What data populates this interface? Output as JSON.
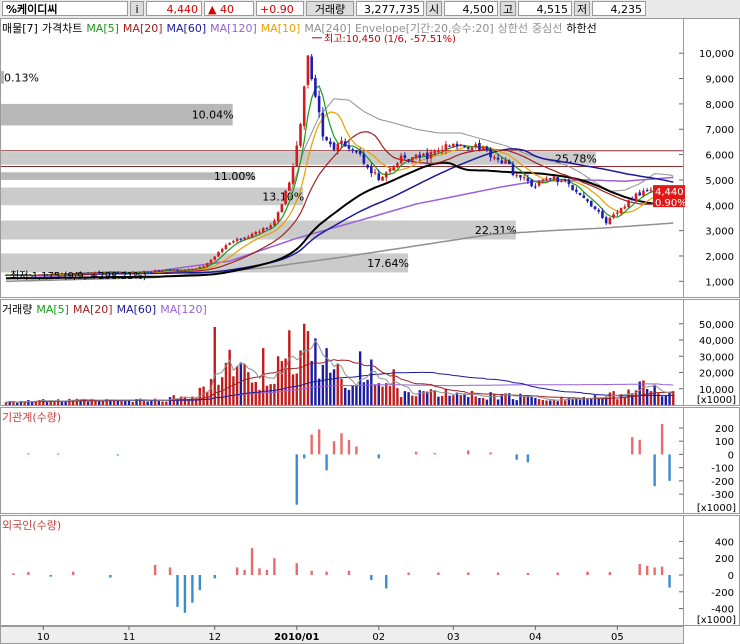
{
  "header": {
    "stock_name": "%케이디씨",
    "info_marker": "i",
    "price": "4,440",
    "change": "▲ 40",
    "change_pct": "+0.90",
    "volume_label": "거래량",
    "volume": "3,277,735",
    "open_label": "시",
    "open": "4,500",
    "high_label": "고",
    "high": "4,515",
    "low_label": "저",
    "low": "4,235"
  },
  "colors": {
    "ma5": "#1a9a1a",
    "ma10": "#e8a000",
    "ma20": "#a02020",
    "ma60": "#1a1a9a",
    "ma120": "#9a60d8",
    "ma240": "#909090",
    "envelope": "#909090",
    "up": "#d41c1c",
    "down": "#1c1cb4",
    "bar_up": "#e86a6a",
    "bar_down": "#3a8ad4",
    "price_tag_bg": "#e01818"
  },
  "chart_data": [
    {
      "type": "candlestick",
      "panel": "price",
      "legend": [
        {
          "text": "매물[7]",
          "color": "#000000"
        },
        {
          "text": "가격차트",
          "color": "#000000"
        },
        {
          "text": "MA[5]",
          "color": "#1a9a1a"
        },
        {
          "text": "MA[20]",
          "color": "#a02020"
        },
        {
          "text": "MA[60]",
          "color": "#1a1a9a"
        },
        {
          "text": "MA[120]",
          "color": "#9a60d8"
        },
        {
          "text": "MA[10]",
          "color": "#e8a000"
        },
        {
          "text": "MA[240]",
          "color": "#909090"
        },
        {
          "text": "Envelope[기간:20,승수:20]",
          "color": "#909090"
        },
        {
          "text": "상한선",
          "color": "#909090"
        },
        {
          "text": "중심선",
          "color": "#909090"
        },
        {
          "text": "하한선",
          "color": "#000000"
        }
      ],
      "ylim": [
        500,
        10600
      ],
      "y_ticks": [
        1000,
        2000,
        3000,
        4000,
        5000,
        6000,
        7000,
        8000,
        9000,
        10000
      ],
      "y_tick_labels": [
        "1,000",
        "2,000",
        "3,000",
        "4,000",
        "5,000",
        "6,000",
        "7,000",
        "8,000",
        "9,000",
        "10,000"
      ],
      "x_labels": [
        {
          "label": "10",
          "index": 10
        },
        {
          "label": "11",
          "index": 33
        },
        {
          "label": "12",
          "index": 56
        },
        {
          "label": "2010/01",
          "index": 78
        },
        {
          "label": "02",
          "index": 100
        },
        {
          "label": "03",
          "index": 120
        },
        {
          "label": "04",
          "index": 142
        },
        {
          "label": "05",
          "index": 164
        }
      ],
      "volume_profile": [
        {
          "price_low": 5600,
          "price_high": 6100,
          "pct_label": "25.78%"
        },
        {
          "price_low": 4000,
          "price_high": 4700,
          "pct_label": "13.10%"
        },
        {
          "price_low": 2650,
          "price_high": 3400,
          "pct_label": "22.31%"
        },
        {
          "price_low": 1350,
          "price_high": 2100,
          "pct_label": "17.64%"
        },
        {
          "price_low": 5000,
          "price_high": 5300,
          "pct_label": "11.00%"
        },
        {
          "price_low": 7150,
          "price_high": 8000,
          "pct_label": "10.04%"
        },
        {
          "price_low": 8800,
          "price_high": 9300,
          "pct_label": "0.13%"
        }
      ],
      "hlines": [
        {
          "value": 6150,
          "color": "#8b2b2b"
        },
        {
          "value": 5530,
          "color": "#8b2b2b"
        }
      ],
      "close_profile": [
        [
          0,
          1220
        ],
        [
          8,
          1240
        ],
        [
          16,
          1300
        ],
        [
          22,
          1350
        ],
        [
          28,
          1370
        ],
        [
          32,
          1320
        ],
        [
          38,
          1380
        ],
        [
          44,
          1450
        ],
        [
          50,
          1470
        ],
        [
          54,
          1680
        ],
        [
          57,
          2150
        ],
        [
          60,
          2500
        ],
        [
          63,
          2650
        ],
        [
          66,
          2850
        ],
        [
          69,
          3100
        ],
        [
          72,
          3400
        ],
        [
          75,
          4450
        ],
        [
          77,
          5600
        ],
        [
          79,
          7200
        ],
        [
          81,
          10100
        ],
        [
          83,
          8300
        ],
        [
          85,
          6800
        ],
        [
          88,
          6200
        ],
        [
          91,
          6500
        ],
        [
          94,
          6100
        ],
        [
          97,
          5600
        ],
        [
          100,
          5000
        ],
        [
          103,
          5300
        ],
        [
          106,
          5850
        ],
        [
          110,
          5850
        ],
        [
          114,
          6000
        ],
        [
          118,
          6300
        ],
        [
          122,
          6350
        ],
        [
          126,
          6400
        ],
        [
          130,
          6050
        ],
        [
          134,
          5650
        ],
        [
          138,
          5050
        ],
        [
          142,
          4800
        ],
        [
          146,
          5100
        ],
        [
          150,
          4900
        ],
        [
          154,
          4500
        ],
        [
          158,
          3850
        ],
        [
          161,
          3350
        ],
        [
          164,
          3650
        ],
        [
          167,
          4150
        ],
        [
          170,
          4450
        ],
        [
          173,
          4750
        ],
        [
          176,
          4550
        ],
        [
          179,
          4440
        ]
      ],
      "high_low_annotations": [
        {
          "text": "최고:10,450 (1/6, -57.51%)",
          "index": 81,
          "value": 10450,
          "color": "#c00000"
        },
        {
          "text": "최저:1,175 (9/9, +298.21%)",
          "index": 0,
          "value": 1175,
          "color": "#000000"
        }
      ],
      "last_price_tag": {
        "price": "4,440",
        "pct": "0.90%",
        "value": 4440
      },
      "envelope_upper_points": [
        [
          76,
          4300
        ],
        [
          80,
          6200
        ],
        [
          84,
          7500
        ],
        [
          88,
          8200
        ],
        [
          92,
          8150
        ],
        [
          96,
          7700
        ],
        [
          100,
          7400
        ],
        [
          104,
          7250
        ],
        [
          110,
          7000
        ],
        [
          116,
          6850
        ],
        [
          122,
          6850
        ],
        [
          128,
          6600
        ],
        [
          134,
          6350
        ],
        [
          140,
          6000
        ],
        [
          146,
          5750
        ],
        [
          150,
          5600
        ],
        [
          154,
          5300
        ],
        [
          158,
          4900
        ],
        [
          162,
          4550
        ],
        [
          166,
          4600
        ],
        [
          170,
          4850
        ],
        [
          174,
          5250
        ],
        [
          178,
          5200
        ],
        [
          179,
          5150
        ]
      ],
      "ma120_points": [
        [
          0,
          1100
        ],
        [
          40,
          1400
        ],
        [
          60,
          1800
        ],
        [
          78,
          2700
        ],
        [
          96,
          3450
        ],
        [
          110,
          4050
        ],
        [
          122,
          4400
        ],
        [
          132,
          4700
        ],
        [
          142,
          4950
        ],
        [
          156,
          5000
        ],
        [
          166,
          4950
        ],
        [
          179,
          5100
        ]
      ],
      "ma240_points": [
        [
          0,
          1000
        ],
        [
          40,
          1150
        ],
        [
          70,
          1550
        ],
        [
          90,
          1950
        ],
        [
          110,
          2400
        ],
        [
          130,
          2850
        ],
        [
          146,
          3000
        ],
        [
          160,
          3100
        ],
        [
          179,
          3300
        ]
      ]
    },
    {
      "type": "bar",
      "panel": "volume",
      "legend": [
        {
          "text": "거래량",
          "color": "#000000"
        },
        {
          "text": "MA[5]",
          "color": "#1a9a1a"
        },
        {
          "text": "MA[20]",
          "color": "#a02020"
        },
        {
          "text": "MA[60]",
          "color": "#1a1a9a"
        },
        {
          "text": "MA[120]",
          "color": "#9a60d8"
        }
      ],
      "unit": "[x1000]",
      "ylim": [
        0,
        56000
      ],
      "y_ticks": [
        10000,
        20000,
        30000,
        40000,
        50000
      ],
      "y_tick_labels": [
        "10,000",
        "20,000",
        "30,000",
        "40,000",
        "50,000"
      ],
      "volume_profile": [
        [
          0,
          2500
        ],
        [
          20,
          2800
        ],
        [
          40,
          3000
        ],
        [
          50,
          6000
        ],
        [
          55,
          14000
        ],
        [
          60,
          22000
        ],
        [
          66,
          18000
        ],
        [
          72,
          16000
        ],
        [
          78,
          30000
        ],
        [
          81,
          38000
        ],
        [
          86,
          22000
        ],
        [
          92,
          16000
        ],
        [
          100,
          12000
        ],
        [
          110,
          8000
        ],
        [
          120,
          7000
        ],
        [
          130,
          6000
        ],
        [
          140,
          5000
        ],
        [
          150,
          4000
        ],
        [
          160,
          4500
        ],
        [
          166,
          8000
        ],
        [
          172,
          12000
        ],
        [
          179,
          7000
        ]
      ],
      "spikes": [
        [
          56,
          48000
        ],
        [
          60,
          34000
        ],
        [
          64,
          25000
        ],
        [
          69,
          35000
        ],
        [
          73,
          30000
        ],
        [
          76,
          46000
        ],
        [
          80,
          50000
        ],
        [
          83,
          41000
        ],
        [
          86,
          35000
        ],
        [
          95,
          33000
        ],
        [
          98,
          28000
        ],
        [
          104,
          22000
        ]
      ]
    },
    {
      "type": "bar",
      "panel": "institutional",
      "legend": [
        {
          "text": "기관계(수량)",
          "color": "#c04040"
        }
      ],
      "unit": "[x1000]",
      "ylim": [
        -420,
        260
      ],
      "y_ticks": [
        -300,
        -200,
        -100,
        0,
        100,
        200
      ],
      "y_tick_labels": [
        "-300",
        "-200",
        "-100",
        "0",
        "100",
        "200"
      ],
      "values": [
        [
          6,
          8
        ],
        [
          14,
          6
        ],
        [
          30,
          -6
        ],
        [
          78,
          -380
        ],
        [
          80,
          -30
        ],
        [
          82,
          150
        ],
        [
          84,
          190
        ],
        [
          86,
          -120
        ],
        [
          88,
          100
        ],
        [
          90,
          160
        ],
        [
          92,
          110
        ],
        [
          94,
          60
        ],
        [
          100,
          -30
        ],
        [
          110,
          20
        ],
        [
          115,
          10
        ],
        [
          124,
          30
        ],
        [
          130,
          15
        ],
        [
          137,
          -40
        ],
        [
          140,
          -60
        ],
        [
          168,
          130
        ],
        [
          170,
          110
        ],
        [
          174,
          -240
        ],
        [
          176,
          230
        ],
        [
          178,
          -200
        ]
      ]
    },
    {
      "type": "bar",
      "panel": "foreign",
      "legend": [
        {
          "text": "외국인(수량)",
          "color": "#c04040"
        }
      ],
      "unit": "[x1000]",
      "ylim": [
        -560,
        560
      ],
      "y_ticks": [
        -400,
        -200,
        0,
        200,
        400
      ],
      "y_tick_labels": [
        "-400",
        "-200",
        "0",
        "200",
        "400"
      ],
      "values": [
        [
          2,
          20
        ],
        [
          6,
          35
        ],
        [
          12,
          -20
        ],
        [
          18,
          40
        ],
        [
          28,
          -30
        ],
        [
          40,
          120
        ],
        [
          44,
          90
        ],
        [
          46,
          -380
        ],
        [
          48,
          -450
        ],
        [
          50,
          -330
        ],
        [
          52,
          -180
        ],
        [
          56,
          -40
        ],
        [
          62,
          90
        ],
        [
          64,
          60
        ],
        [
          66,
          320
        ],
        [
          68,
          80
        ],
        [
          70,
          60
        ],
        [
          72,
          200
        ],
        [
          78,
          140
        ],
        [
          82,
          50
        ],
        [
          86,
          40
        ],
        [
          92,
          50
        ],
        [
          98,
          -60
        ],
        [
          102,
          -160
        ],
        [
          108,
          30
        ],
        [
          116,
          30
        ],
        [
          124,
          30
        ],
        [
          132,
          30
        ],
        [
          140,
          25
        ],
        [
          148,
          30
        ],
        [
          156,
          40
        ],
        [
          162,
          35
        ],
        [
          170,
          130
        ],
        [
          172,
          110
        ],
        [
          174,
          90
        ],
        [
          176,
          100
        ],
        [
          178,
          -150
        ]
      ]
    }
  ]
}
